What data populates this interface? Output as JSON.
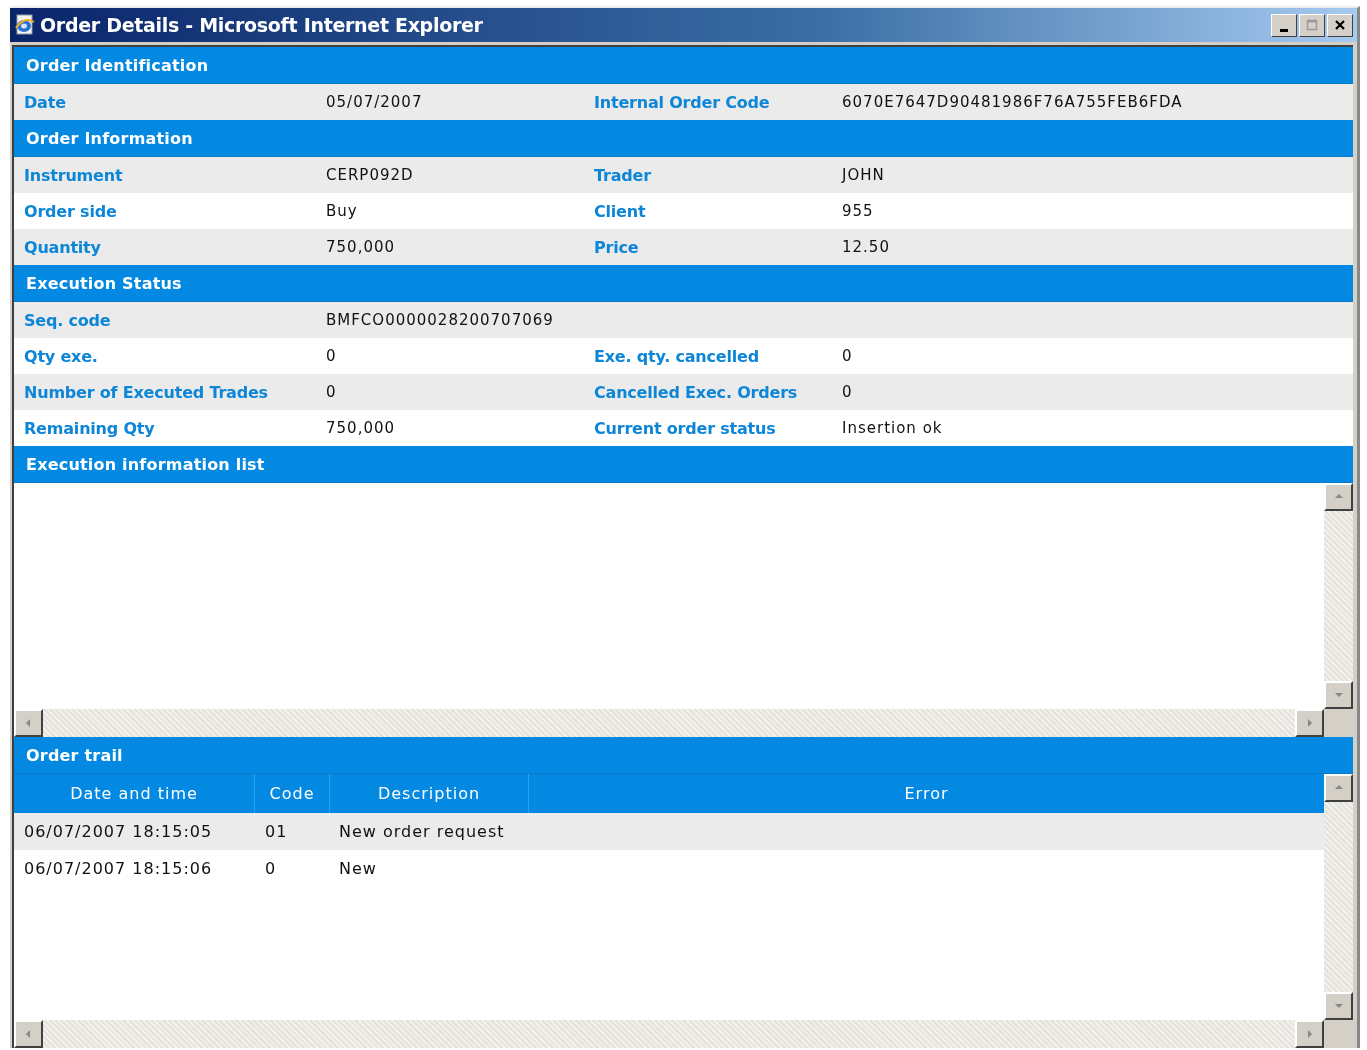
{
  "window": {
    "title": "Order Details - Microsoft Internet Explorer"
  },
  "sections": [
    {
      "title": "Order Identification",
      "rows": [
        [
          {
            "label": "Date",
            "value": "05/07/2007"
          },
          {
            "label": "Internal Order Code",
            "value": "6070E7647D90481986F76A755FEB6FDA"
          }
        ]
      ]
    },
    {
      "title": "Order Information",
      "rows": [
        [
          {
            "label": "Instrument",
            "value": "CERP092D"
          },
          {
            "label": "Trader",
            "value": "JOHN"
          }
        ],
        [
          {
            "label": "Order side",
            "value": "Buy"
          },
          {
            "label": "Client",
            "value": "955"
          }
        ],
        [
          {
            "label": "Quantity",
            "value": "750,000"
          },
          {
            "label": "Price",
            "value": "12.50"
          }
        ]
      ]
    },
    {
      "title": "Execution Status",
      "rows": [
        [
          {
            "label": "Seq. code",
            "value": "BMFCO0000028200707069"
          }
        ],
        [
          {
            "label": "Qty exe.",
            "value": "0"
          },
          {
            "label": "Exe. qty. cancelled",
            "value": "0"
          }
        ],
        [
          {
            "label": "Number of Executed Trades",
            "value": "0"
          },
          {
            "label": "Cancelled Exec. Orders",
            "value": "0"
          }
        ],
        [
          {
            "label": "Remaining Qty",
            "value": "750,000"
          },
          {
            "label": "Current order status",
            "value": "Insertion ok"
          }
        ]
      ]
    }
  ],
  "execution_list": {
    "title": "Execution information list"
  },
  "order_trail": {
    "title": "Order trail",
    "columns": [
      "Date and time",
      "Code",
      "Description",
      "Error"
    ],
    "rows": [
      [
        "06/07/2007 18:15:05",
        "01",
        "New order request"
      ],
      [
        "06/07/2007 18:15:06",
        "0",
        "New"
      ]
    ]
  }
}
